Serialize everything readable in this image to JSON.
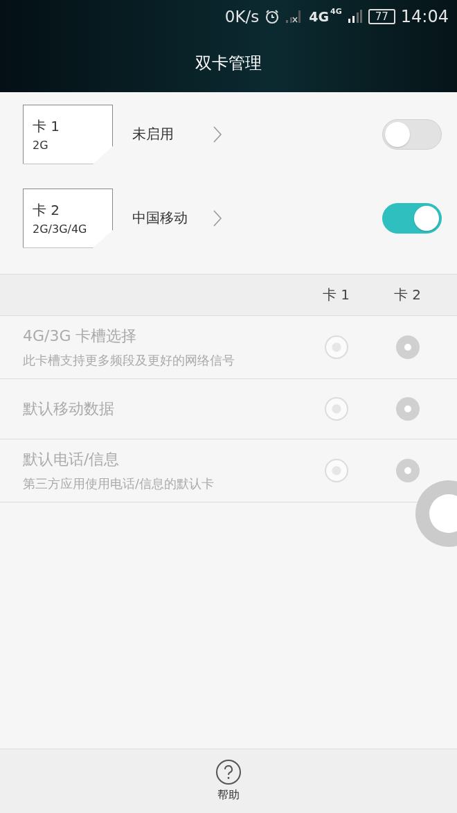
{
  "status_bar": {
    "speed": "0K/s",
    "network_main": "4G",
    "network_small": "4G",
    "battery": "77",
    "time": "14:04"
  },
  "title": "双卡管理",
  "sims": [
    {
      "name": "卡 1",
      "bands": "2G",
      "operator": "未启用",
      "on": false
    },
    {
      "name": "卡 2",
      "bands": "2G/3G/4G",
      "operator": "中国移动",
      "on": true
    }
  ],
  "columns": [
    "卡 1",
    "卡 2"
  ],
  "settings": [
    {
      "title": "4G/3G 卡槽选择",
      "subtitle": "此卡槽支持更多频段及更好的网络信号",
      "disabled": true,
      "options": [
        {
          "selected": false
        },
        {
          "selected": true
        }
      ]
    },
    {
      "title": "默认移动数据",
      "disabled": true,
      "options": [
        {
          "selected": false
        },
        {
          "selected": true
        }
      ]
    },
    {
      "title": "默认电话/信息",
      "subtitle": "第三方应用使用电话/信息的默认卡",
      "disabled": true,
      "options": [
        {
          "selected": false
        },
        {
          "selected": true
        }
      ]
    }
  ],
  "help": {
    "label": "帮助"
  }
}
